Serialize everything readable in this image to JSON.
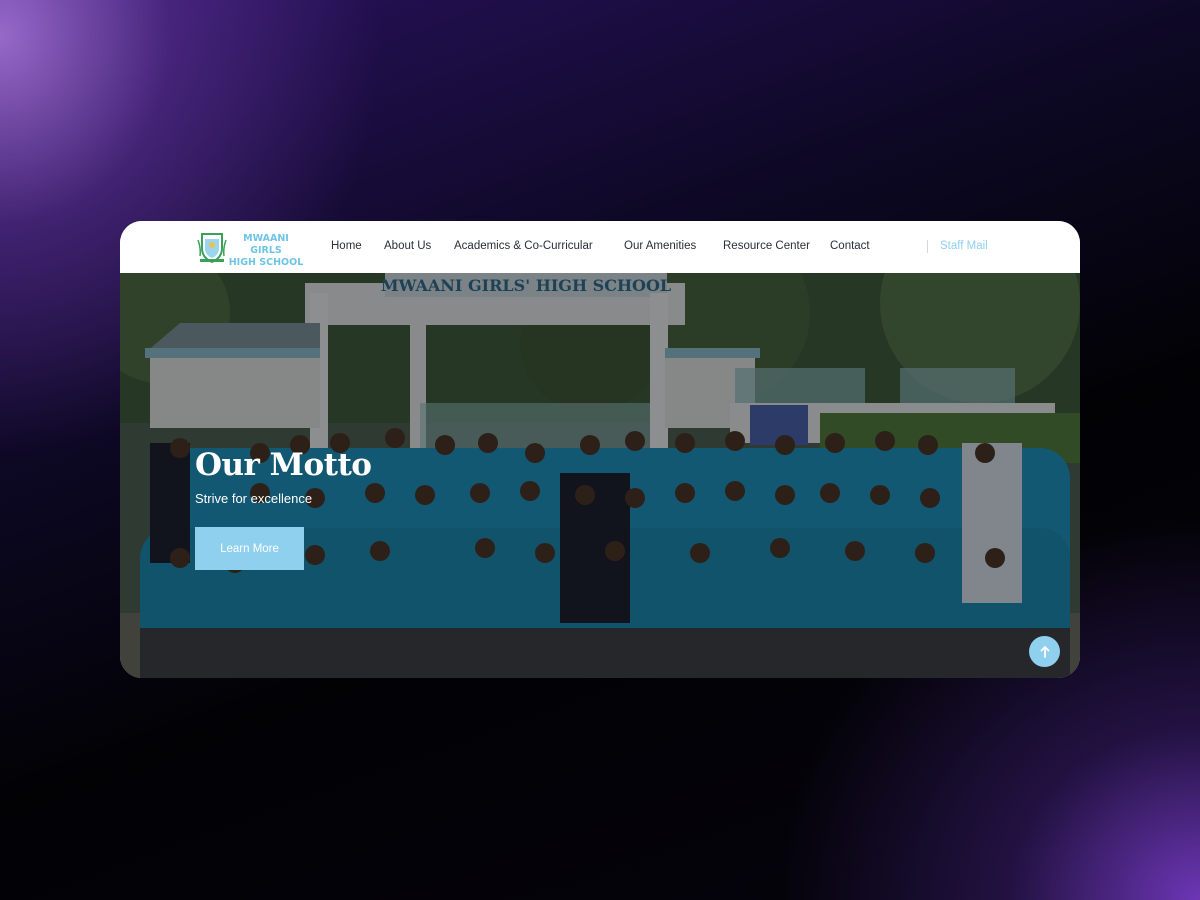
{
  "header": {
    "logo_line1": "MWAANI GIRLS",
    "logo_line2": "HIGH SCHOOL",
    "nav": [
      {
        "label": "Home"
      },
      {
        "label": "About Us"
      },
      {
        "label": "Academics & Co-Curricular"
      },
      {
        "label": "Our Amenities"
      },
      {
        "label": "Resource Center"
      },
      {
        "label": "Contact"
      }
    ],
    "staff_mail": "Staff Mail"
  },
  "hero": {
    "sign_text": "MWAANI GIRLS' HIGH SCHOOL",
    "title": "Our Motto",
    "subtitle": "Strive for excellence",
    "button_label": "Learn More"
  },
  "icons": {
    "crest": "school-crest-icon",
    "scroll_top": "arrow-up-icon"
  },
  "colors": {
    "accent": "#8fd0ee",
    "nav_text": "#2b2f3a",
    "uniform": "#1f8fb8"
  }
}
